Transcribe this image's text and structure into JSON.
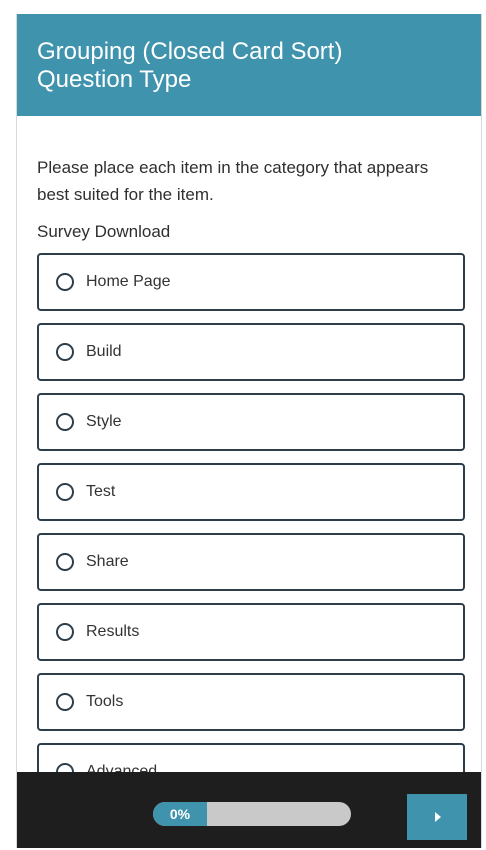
{
  "header": {
    "title_line1": "Grouping (Closed Card Sort)",
    "title_line2": "Question Type"
  },
  "question": {
    "instructions": "Please place each item in the category that appears best suited for the item.",
    "label": "Survey Download",
    "options": [
      {
        "label": "Home Page"
      },
      {
        "label": "Build"
      },
      {
        "label": "Style"
      },
      {
        "label": "Test"
      },
      {
        "label": "Share"
      },
      {
        "label": "Results"
      },
      {
        "label": "Tools"
      },
      {
        "label": "Advanced"
      }
    ]
  },
  "footer": {
    "progress_text": "0%",
    "progress_value": 0
  },
  "colors": {
    "accent": "#3f93ac",
    "footer_bg": "#1e1e1e",
    "border": "#2d3e4a"
  }
}
